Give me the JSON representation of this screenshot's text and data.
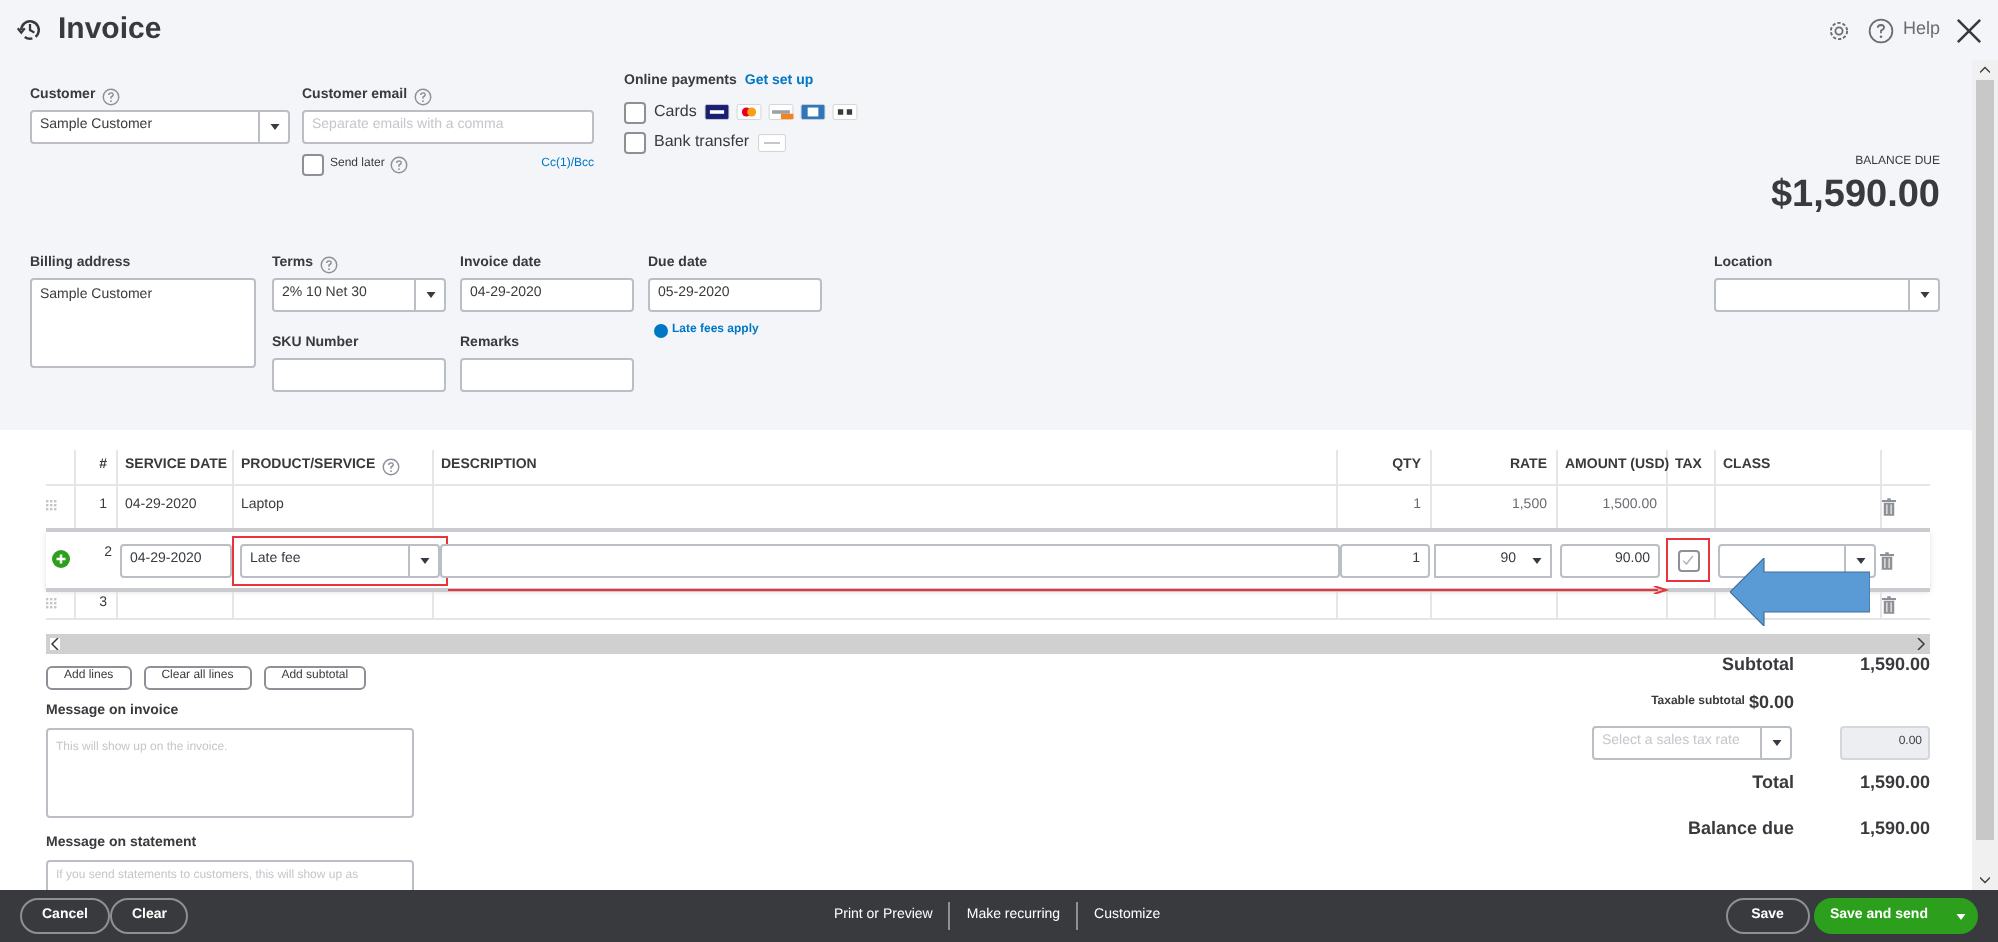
{
  "header": {
    "title": "Invoice",
    "help": "Help"
  },
  "customer": {
    "label": "Customer",
    "value": "Sample Customer"
  },
  "customer_email": {
    "label": "Customer email",
    "placeholder": "Separate emails with a comma",
    "send_later": {
      "label": "Send later",
      "checked": false
    },
    "cc_bcc": "Cc(1)/Bcc"
  },
  "online_payments": {
    "label": "Online payments",
    "link": "Get set up",
    "options": [
      {
        "kind": "cards",
        "label": "Cards",
        "checked": false
      },
      {
        "kind": "bank",
        "label": "Bank transfer",
        "checked": false
      }
    ]
  },
  "balance_due": {
    "label": "BALANCE DUE",
    "amount": "$1,590.00"
  },
  "billing_address": {
    "label": "Billing address",
    "value": "Sample Customer"
  },
  "terms": {
    "label": "Terms",
    "value": "2% 10 Net 30"
  },
  "invoice_date": {
    "label": "Invoice date",
    "value": "04-29-2020"
  },
  "due_date": {
    "label": "Due date",
    "value": "05-29-2020",
    "note": "Late fees apply"
  },
  "sku_number": {
    "label": "SKU Number"
  },
  "remarks": {
    "label": "Remarks"
  },
  "location": {
    "label": "Location"
  },
  "table": {
    "columns": [
      "#",
      "SERVICE DATE",
      "PRODUCT/SERVICE",
      "DESCRIPTION",
      "QTY",
      "RATE",
      "AMOUNT (USD)",
      "TAX",
      "CLASS"
    ],
    "rows": [
      {
        "kind": "view",
        "number": "1",
        "service_date": "04-29-2020",
        "product": "Laptop",
        "qty": "1",
        "rate": "1,500",
        "amount": "1,500.00"
      },
      {
        "kind": "edit",
        "number": "2",
        "service_date": "04-29-2020",
        "product": "Late fee",
        "qty": "1",
        "rate": "90",
        "amount": "90.00",
        "tax_checked": true
      },
      {
        "kind": "view",
        "number": "3"
      }
    ]
  },
  "line_buttons": [
    "Add lines",
    "Clear all lines",
    "Add subtotal"
  ],
  "message_invoice": {
    "label": "Message on invoice",
    "placeholder": "This will show up on the invoice."
  },
  "message_statement": {
    "label": "Message on statement",
    "placeholder": "If you send statements to customers, this will show up as"
  },
  "totals": {
    "subtotal": {
      "label": "Subtotal",
      "value": "1,590.00"
    },
    "taxable": {
      "label": "Taxable subtotal",
      "value": "$0.00"
    },
    "tax_rate": {
      "placeholder": "Select a sales tax rate",
      "value": "0.00"
    },
    "total": {
      "label": "Total",
      "value": "1,590.00"
    },
    "balance_due": {
      "label": "Balance due",
      "value": "1,590.00"
    }
  },
  "footer": {
    "left": [
      "Cancel",
      "Clear"
    ],
    "center": [
      "Print or Preview",
      "Make recurring",
      "Customize"
    ],
    "save": "Save",
    "save_send": "Save and send"
  }
}
